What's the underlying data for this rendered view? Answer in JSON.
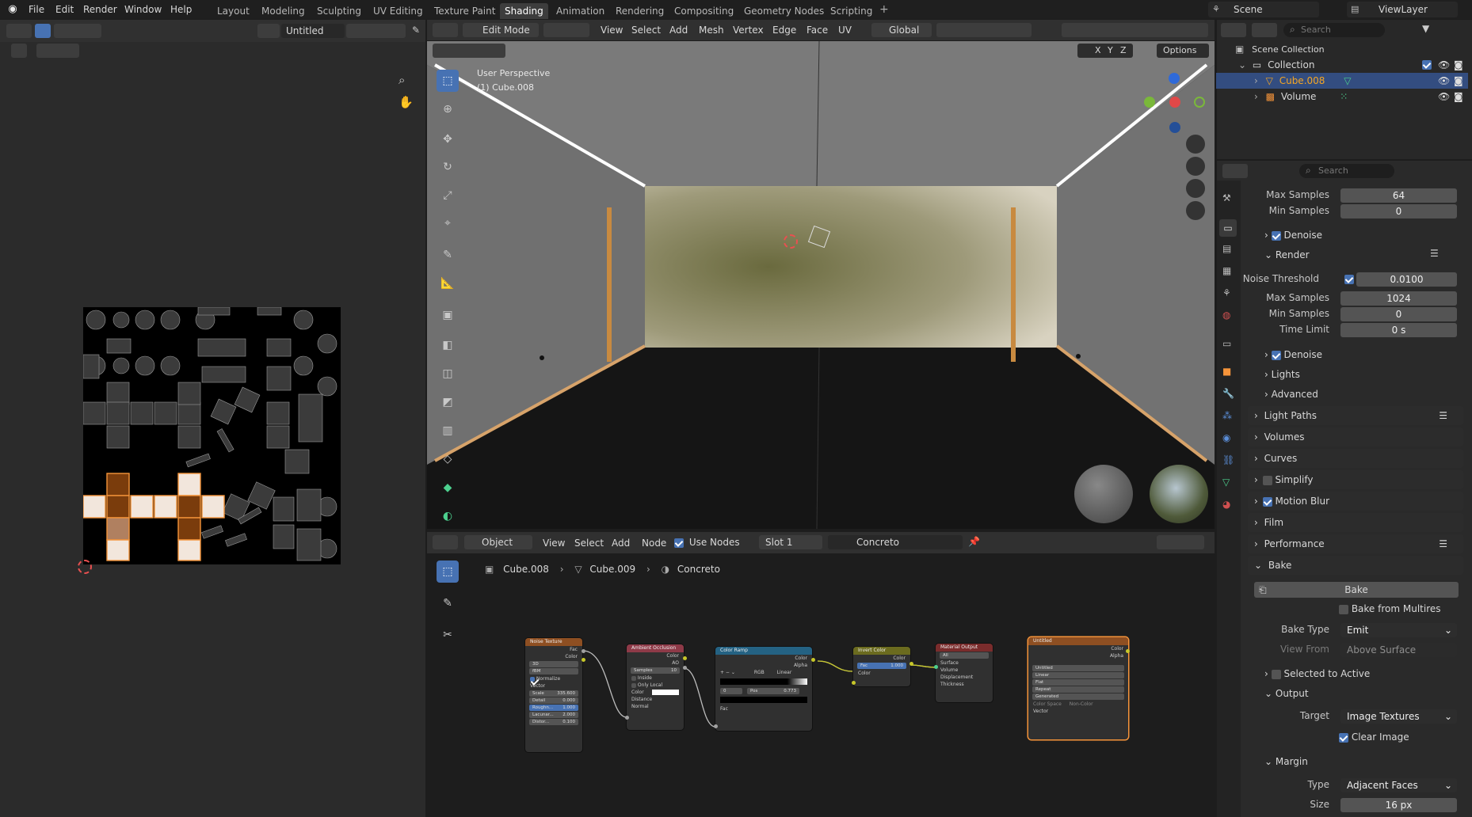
{
  "topbar": {
    "menus": [
      "File",
      "Edit",
      "Render",
      "Window",
      "Help"
    ],
    "workspaces": [
      "Layout",
      "Modeling",
      "Sculpting",
      "UV Editing",
      "Texture Paint",
      "Shading",
      "Animation",
      "Rendering",
      "Compositing",
      "Geometry Nodes",
      "Scripting"
    ],
    "active_workspace": "Shading",
    "add_tab": "+",
    "scene": "Scene",
    "view_layer": "ViewLayer"
  },
  "image_editor": {
    "image_name": "Untitled"
  },
  "viewport": {
    "mode": "Edit Mode",
    "menus": [
      "View",
      "Select",
      "Add",
      "Mesh",
      "Vertex",
      "Edge",
      "Face",
      "UV"
    ],
    "transform_orientation": "Global",
    "axes": [
      "X",
      "Y",
      "Z"
    ],
    "options_label": "Options",
    "info_line1": "User Perspective",
    "info_line2": "(1) Cube.008"
  },
  "node_editor": {
    "object_mode": "Object",
    "menus": [
      "View",
      "Select",
      "Add",
      "Node"
    ],
    "use_nodes_label": "Use Nodes",
    "slot": "Slot 1",
    "material": "Concreto",
    "breadcrumb": [
      "Cube.008",
      "Cube.009",
      "Concreto"
    ],
    "nodes": {
      "noise": {
        "title": "Noise Texture",
        "out1": "Fac",
        "out2": "Color",
        "dim": "3D",
        "type": "fBM",
        "normalize": "Normalize",
        "vector": "Vector",
        "scale": "Scale",
        "scale_v": "335.600",
        "detail": "Detail",
        "detail_v": "0.000",
        "rough": "Roughn...",
        "rough_v": "1.000",
        "lac": "Lacunar...",
        "lac_v": "2.000",
        "dist": "Distor...",
        "dist_v": "0.100"
      },
      "ao": {
        "title": "Ambient Occlusion",
        "out1": "Color",
        "out2": "AO",
        "samples": "Samples",
        "samples_v": "10",
        "inside": "Inside",
        "only_local": "Only Local",
        "color": "Color",
        "distance": "Distance",
        "normal": "Normal"
      },
      "ramp": {
        "title": "Color Ramp",
        "out1": "Color",
        "out2": "Alpha",
        "mode": "RGB",
        "interp": "Linear",
        "idx": "0",
        "pos": "Pos",
        "pos_v": "0.773",
        "fac": "Fac"
      },
      "invert": {
        "title": "Invert Color",
        "out1": "Color",
        "fac": "Fac",
        "fac_v": "1.000",
        "color": "Color"
      },
      "matout": {
        "title": "Material Output",
        "target": "All",
        "surface": "Surface",
        "volume": "Volume",
        "disp": "Displacement",
        "thick": "Thickness"
      },
      "image": {
        "title": "Untitled",
        "out1": "Color",
        "out2": "Alpha",
        "img": "Untitled",
        "interp": "Linear",
        "proj": "Flat",
        "ext": "Repeat",
        "src": "Generated",
        "cs": "Color Space",
        "cs_v": "Non-Color",
        "vector": "Vector"
      }
    }
  },
  "outliner": {
    "search_placeholder": "Search",
    "root": "Scene Collection",
    "collection": "Collection",
    "items": [
      "Cube.008",
      "Volume"
    ]
  },
  "properties": {
    "search_placeholder": "Search",
    "rows": {
      "max_samples_top": {
        "label": "Max Samples",
        "value": "64"
      },
      "min_samples_top": {
        "label": "Min Samples",
        "value": "0"
      },
      "denoise1": "Denoise",
      "render": "Render",
      "noise_threshold": {
        "label": "Noise Threshold",
        "value": "0.0100"
      },
      "max_samples": {
        "label": "Max Samples",
        "value": "1024"
      },
      "min_samples": {
        "label": "Min Samples",
        "value": "0"
      },
      "time_limit": {
        "label": "Time Limit",
        "value": "0 s"
      },
      "denoise2": "Denoise",
      "lights": "Lights",
      "advanced": "Advanced"
    },
    "panels": [
      "Light Paths",
      "Volumes",
      "Curves",
      "Simplify",
      "Motion Blur",
      "Film",
      "Performance",
      "Bake"
    ],
    "bake": {
      "bake_button": "Bake",
      "bake_from_multires": "Bake from Multires",
      "bake_type": {
        "label": "Bake Type",
        "value": "Emit"
      },
      "view_from": {
        "label": "View From",
        "value": "Above Surface"
      },
      "selected_to_active": "Selected to Active",
      "output": "Output",
      "target": {
        "label": "Target",
        "value": "Image Textures"
      },
      "clear_image": "Clear Image",
      "margin": "Margin",
      "type": {
        "label": "Type",
        "value": "Adjacent Faces"
      },
      "size": {
        "label": "Size",
        "value": "16 px"
      }
    }
  },
  "colors": {
    "accent": "#4772b3",
    "selection": "#f5943a",
    "active_object": "#f5a623"
  }
}
